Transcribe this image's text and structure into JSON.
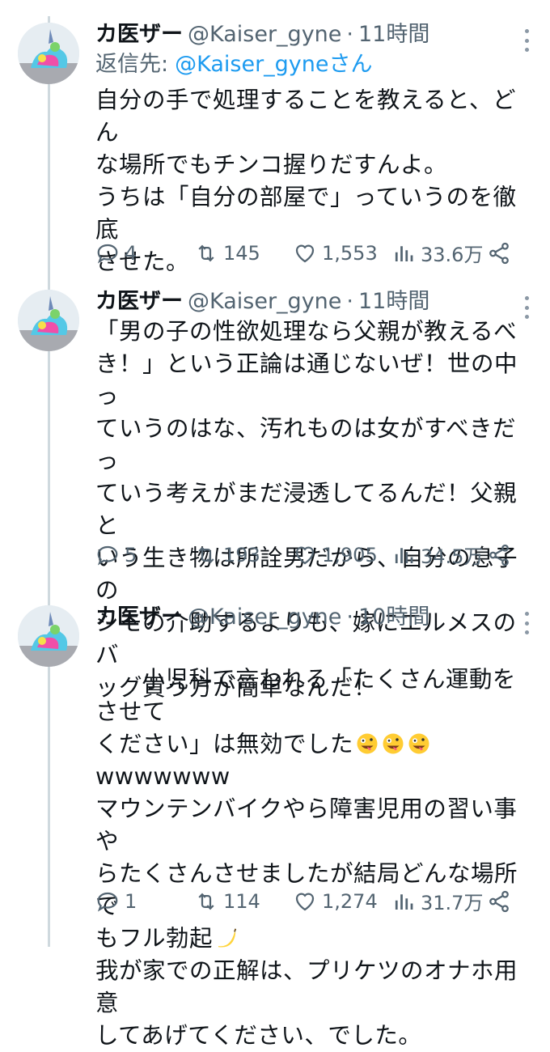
{
  "tweets": [
    {
      "name": "カ医ザー",
      "handle": "@Kaiser_gyne",
      "dot": "·",
      "time": "11時間",
      "reply_label": "返信先:",
      "reply_mention": "@Kaiser_gyneさん",
      "body": "自分の手で処理することを教えると、どん\nな場所でもチンコ握りだすんよ。\nうちは「自分の部屋で」っていうのを徹底\nさせた。",
      "replies": "4",
      "retweets": "145",
      "likes": "1,553",
      "views": "33.6万"
    },
    {
      "name": "カ医ザー",
      "handle": "@Kaiser_gyne",
      "dot": "·",
      "time": "11時間",
      "body": "「男の子の性欲処理なら父親が教えるべ\nき！」という正論は通じないぜ！世の中っ\nていうのはな、汚れものは女がすべきだっ\nていう考えがまだ浸透してるんだ！父親と\nいう生き物は所詮男だから、自分の息子の\nシモの介助するよりも、嫁にエルメスのバ\nッグ買う方が簡単なんだ！",
      "replies": "5",
      "retweets": "193",
      "likes": "1,905",
      "views": "34.5万"
    },
    {
      "name": "カ医ザー",
      "handle": "@Kaiser_gyne",
      "dot": "·",
      "time": "10時間",
      "body_line1": "小児科で言われる「たくさん運動をさせて",
      "body_line2": "ください」は無効でした",
      "body_rest1": "wwwwwww\nマウンテンバイクやら障害児用の習い事や\nらたくさんさせましたが結局どんな場所で\nもフル勃起",
      "body_rest2": "我が家での正解は、プリケツのオナホ用意\nしてあげてください、でした。",
      "replies": "1",
      "retweets": "114",
      "likes": "1,274",
      "views": "31.7万"
    }
  ],
  "icons": {
    "reply": "speech-bubble-icon",
    "retweet": "retweet-icon",
    "like": "heart-icon",
    "views": "bar-chart-icon",
    "share": "share-icon",
    "more": "more-vertical-icon",
    "emoji_tongue": "zany-face-emoji",
    "emoji_banana": "banana-emoji"
  },
  "colors": {
    "accent": "#1d9bf0",
    "secondary_text": "#536471",
    "thread_line": "#cfd9de"
  }
}
